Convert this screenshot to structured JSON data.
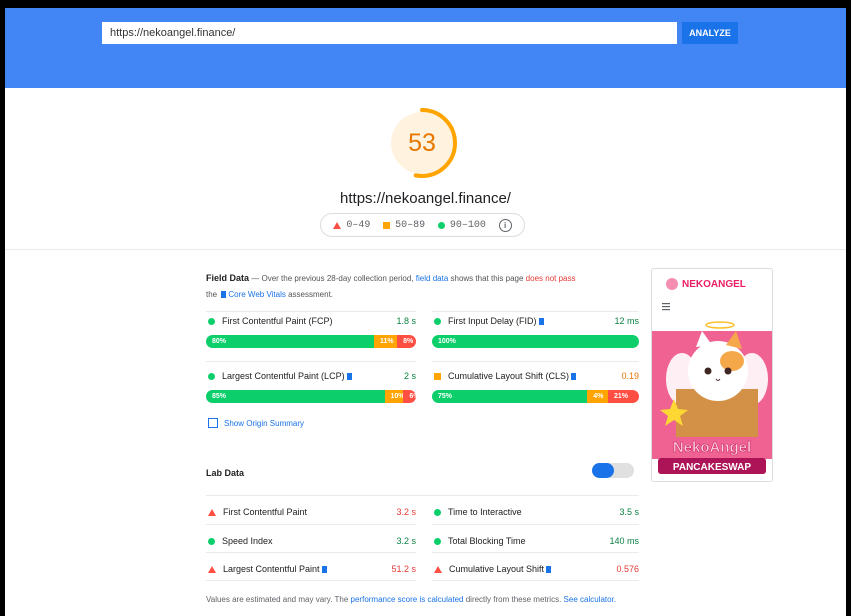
{
  "header": {
    "url_value": "https://nekoangel.finance/",
    "analyze_label": "ANALYZE"
  },
  "summary": {
    "score": "53",
    "score_fraction": 0.53,
    "url": "https://nekoangel.finance/",
    "legend": {
      "fail": "0–49",
      "average": "50–89",
      "pass": "90–100",
      "info": "i"
    }
  },
  "field_data": {
    "title": "Field Data",
    "desc_pre": "— Over the previous 28-day collection period,",
    "desc_link": "field data",
    "desc_mid": "shows that this page",
    "desc_fail": "does not pass",
    "desc_the": "the",
    "desc_cwv": "Core Web Vitals",
    "desc_end": "assessment.",
    "metrics": [
      {
        "name": "First Contentful Paint (FCP)",
        "value": "1.8 s",
        "status": "pass",
        "bar": [
          {
            "label": "80%",
            "pct": 80
          },
          {
            "label": "11%",
            "pct": 11
          },
          {
            "label": "8%",
            "pct": 9
          }
        ]
      },
      {
        "name": "First Input Delay (FID)",
        "value": "12 ms",
        "status": "pass",
        "bar": [
          {
            "label": "100%",
            "pct": 100
          }
        ]
      },
      {
        "name": "Largest Contentful Paint (LCP)",
        "value": "2 s",
        "status": "pass",
        "bar": [
          {
            "label": "85%",
            "pct": 85
          },
          {
            "label": "10%",
            "pct": 9
          },
          {
            "label": "6%",
            "pct": 6
          }
        ]
      },
      {
        "name": "Cumulative Layout Shift (CLS)",
        "value": "0.19",
        "status": "average",
        "bar": [
          {
            "label": "75%",
            "pct": 75
          },
          {
            "label": "4%",
            "pct": 10
          },
          {
            "label": "21%",
            "pct": 15
          }
        ]
      }
    ],
    "show_origin": "Show Origin Summary"
  },
  "lab_data": {
    "title": "Lab Data",
    "metrics": [
      {
        "name": "First Contentful Paint",
        "value": "3.2 s",
        "status": "fail"
      },
      {
        "name": "Time to Interactive",
        "value": "3.5 s",
        "status": "pass"
      },
      {
        "name": "Speed Index",
        "value": "3.2 s",
        "status": "pass"
      },
      {
        "name": "Total Blocking Time",
        "value": "140 ms",
        "status": "pass"
      },
      {
        "name": "Largest Contentful Paint",
        "value": "51.2 s",
        "status": "fail"
      },
      {
        "name": "Cumulative Layout Shift",
        "value": "0.576",
        "status": "fail"
      }
    ],
    "footnote_pre": "Values are estimated and may vary. The",
    "footnote_link": "performance score is calculated",
    "footnote_mid": "directly from these metrics.",
    "footnote_calc": "See calculator."
  },
  "thumbnail": {
    "brand": "NEKOANGEL",
    "title": "NekoAngel",
    "subtitle": "PANCAKESWAP"
  },
  "colors": {
    "fail": "#ff4e42",
    "average": "#ffa400",
    "pass": "#0cce6b",
    "accent": "#1a73e8",
    "header": "#4285f4"
  }
}
